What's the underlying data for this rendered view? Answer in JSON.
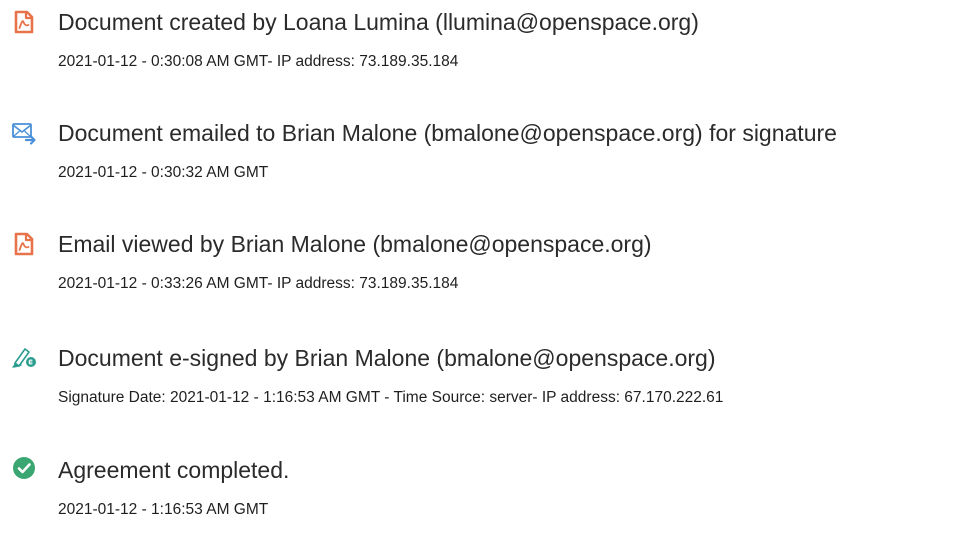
{
  "events": [
    {
      "icon": "document-created-icon",
      "title": "Document created by Loana Lumina (llumina@openspace.org)",
      "detail": "2021-01-12 - 0:30:08 AM GMT- IP address: 73.189.35.184"
    },
    {
      "icon": "email-sent-icon",
      "title": "Document emailed to Brian Malone (bmalone@openspace.org) for signature",
      "detail": "2021-01-12 - 0:30:32 AM GMT"
    },
    {
      "icon": "document-viewed-icon",
      "title": "Email viewed by Brian Malone (bmalone@openspace.org)",
      "detail": "2021-01-12 - 0:33:26 AM GMT- IP address: 73.189.35.184"
    },
    {
      "icon": "e-sign-pen-icon",
      "title": "Document e-signed by Brian Malone (bmalone@openspace.org)",
      "detail": "Signature Date: 2021-01-12 - 1:16:53 AM GMT - Time Source: server- IP address: 67.170.222.61"
    },
    {
      "icon": "check-circle-icon",
      "title": "Agreement completed.",
      "detail": "2021-01-12 - 1:16:53 AM GMT"
    }
  ],
  "colors": {
    "acrobat_orange": "#e8734a",
    "email_blue": "#4a90d9",
    "sign_teal": "#2a9d8f",
    "complete_green": "#3aa672",
    "text": "#2b2b2b"
  }
}
